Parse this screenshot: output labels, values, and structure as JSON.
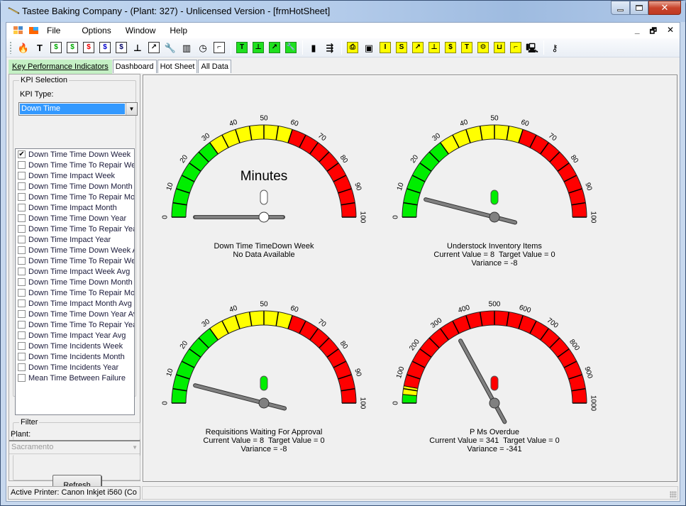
{
  "window": {
    "title": "Tastee Baking Company - (Plant: 327) - Unlicensed Version - [frmHotSheet]",
    "caption_buttons": {
      "minimize": "minimize",
      "maximize": "maximize",
      "close": "✕"
    }
  },
  "menubar": {
    "items": [
      "File",
      "Options",
      "Window",
      "Help"
    ],
    "mdi_controls": {
      "minimize": "_",
      "restore": "🗗",
      "close": "✕"
    }
  },
  "toolbar": {
    "buttons": [
      {
        "icon": "fire-icon",
        "glyph": "🔥",
        "style": "plain"
      },
      {
        "icon": "bolt-icon",
        "glyph": "T",
        "style": "plain"
      },
      {
        "icon": "dollar-doc-green-icon",
        "glyph": "$",
        "color": "#0a0"
      },
      {
        "icon": "dollar-doc-green-2-icon",
        "glyph": "$",
        "color": "#0a0"
      },
      {
        "icon": "dollar-doc-red-icon",
        "glyph": "$",
        "color": "#e00"
      },
      {
        "icon": "dollar-doc-blue-icon",
        "glyph": "$",
        "color": "#00c"
      },
      {
        "icon": "dollar-doc-navy-icon",
        "glyph": "$",
        "color": "#006"
      },
      {
        "icon": "lamp-icon",
        "glyph": "⊥",
        "style": "plain"
      },
      {
        "icon": "hammer-icon",
        "glyph": "↗"
      },
      {
        "icon": "wrench-icon",
        "glyph": "🔧",
        "style": "plain"
      },
      {
        "icon": "panel-icon",
        "glyph": "▥",
        "style": "plain"
      },
      {
        "icon": "clock-icon",
        "glyph": "◷",
        "style": "plain"
      },
      {
        "icon": "stairs-icon",
        "glyph": "⌐"
      },
      {
        "sep": true
      },
      {
        "icon": "bolt-green-icon",
        "glyph": "T",
        "style": "green"
      },
      {
        "icon": "lamp-green-icon",
        "glyph": "⊥",
        "style": "green"
      },
      {
        "icon": "hammer-green-icon",
        "glyph": "↗",
        "style": "green"
      },
      {
        "icon": "wrench-green-icon",
        "glyph": "🔧",
        "style": "green"
      },
      {
        "sep": true
      },
      {
        "icon": "bar-chart-icon",
        "glyph": "▮",
        "style": "plain"
      },
      {
        "icon": "flow-icon",
        "glyph": "⇶",
        "style": "plain"
      },
      {
        "sep": true
      },
      {
        "icon": "printer-icon",
        "glyph": "⎙",
        "style": "yellow"
      },
      {
        "icon": "monitor-icon",
        "glyph": "▣",
        "style": "plain"
      },
      {
        "icon": "signal-i-icon",
        "glyph": "I",
        "style": "yellow"
      },
      {
        "icon": "signal-s-icon",
        "glyph": "S",
        "style": "yellow"
      },
      {
        "icon": "hammer-yellow-icon",
        "glyph": "↗",
        "style": "yellow"
      },
      {
        "icon": "lamp-yellow-icon",
        "glyph": "⊥",
        "style": "yellow"
      },
      {
        "icon": "dollar-yellow-icon",
        "glyph": "$",
        "style": "yellow"
      },
      {
        "icon": "bolt-yellow-icon",
        "glyph": "T",
        "style": "yellow"
      },
      {
        "icon": "gears-yellow-icon",
        "glyph": "⚙",
        "style": "yellow"
      },
      {
        "icon": "factory-yellow-icon",
        "glyph": "⊔",
        "style": "yellow"
      },
      {
        "icon": "stairs-yellow-icon",
        "glyph": "⌐",
        "style": "yellow"
      },
      {
        "icon": "computer-icon",
        "glyph": "🖳",
        "style": "plain"
      },
      {
        "sep": true
      },
      {
        "icon": "key-icon",
        "glyph": "⚷",
        "style": "plain"
      }
    ]
  },
  "tabs": [
    {
      "label": "Key Performance Indicators",
      "active": true
    },
    {
      "label": "Dashboard",
      "active": false
    },
    {
      "label": "Hot Sheet",
      "active": false
    },
    {
      "label": "All Data",
      "active": false
    }
  ],
  "sidebar": {
    "kpi_group_title": "KPI Selection",
    "kpi_type_label": "KPI Type:",
    "kpi_type_value": "Down Time",
    "kpi_items": [
      {
        "label": "Down Time Time Down Week",
        "checked": true
      },
      {
        "label": "Down Time Time To Repair Week",
        "checked": false
      },
      {
        "label": "Down Time Impact Week",
        "checked": false
      },
      {
        "label": "Down Time Time Down Month",
        "checked": false
      },
      {
        "label": "Down Time Time To Repair Month",
        "checked": false
      },
      {
        "label": "Down Time Impact Month",
        "checked": false
      },
      {
        "label": "Down Time Time Down Year",
        "checked": false
      },
      {
        "label": "Down Time Time To Repair Year",
        "checked": false
      },
      {
        "label": "Down Time Impact Year",
        "checked": false
      },
      {
        "label": "Down Time Time Down Week Avg",
        "checked": false
      },
      {
        "label": "Down Time Time To Repair Week Avg",
        "checked": false
      },
      {
        "label": "Down Time Impact Week Avg",
        "checked": false
      },
      {
        "label": "Down Time Time Down Month Avg",
        "checked": false
      },
      {
        "label": "Down Time Time To Repair Month Avg",
        "checked": false
      },
      {
        "label": "Down Time Impact Month Avg",
        "checked": false
      },
      {
        "label": "Down Time Time Down Year Avg",
        "checked": false
      },
      {
        "label": "Down Time Time To Repair Year Avg",
        "checked": false
      },
      {
        "label": "Down Time Impact Year Avg",
        "checked": false
      },
      {
        "label": "Down Time Incidents Week",
        "checked": false
      },
      {
        "label": "Down Time Incidents Month",
        "checked": false
      },
      {
        "label": "Down Time Incidents Year",
        "checked": false
      },
      {
        "label": "Mean Time Between Failure",
        "checked": false
      }
    ],
    "filter_group_title": "Filter",
    "plant_label": "Plant:",
    "plant_value": "Sacramento",
    "refresh_label": "Refresh"
  },
  "status": {
    "printer": "Active Printer: Canon Inkjet i560 (Co"
  },
  "colors": {
    "green": "#00ee00",
    "yellow": "#ffff00",
    "red": "#ff0000",
    "needle": "#808080",
    "active_tab": "#c4f0c4",
    "selection": "#3399ff"
  },
  "chart_data": [
    {
      "type": "gauge",
      "title": "Down Time TimeDown Week",
      "unit_label": "Minutes",
      "lines": [
        "Down Time TimeDown Week",
        "No Data Available"
      ],
      "min": 0,
      "max": 100,
      "major_step": 10,
      "segments": 20,
      "ticks": [
        "0",
        "10",
        "20",
        "30",
        "40",
        "50",
        "60",
        "70",
        "80",
        "90",
        "100"
      ],
      "bands": [
        {
          "from": 0,
          "to": 30,
          "color": "green"
        },
        {
          "from": 30,
          "to": 60,
          "color": "yellow"
        },
        {
          "from": 60,
          "to": 100,
          "color": "red"
        }
      ],
      "value": null,
      "indicator": "none",
      "needle_style": "no-data"
    },
    {
      "type": "gauge",
      "title": "Understock Inventory Items",
      "lines": [
        "Understock Inventory Items",
        "Current Value = 8  Target Value = 0",
        "Variance = -8"
      ],
      "min": 0,
      "max": 100,
      "major_step": 10,
      "segments": 20,
      "ticks": [
        "0",
        "10",
        "20",
        "30",
        "40",
        "50",
        "60",
        "70",
        "80",
        "90",
        "100"
      ],
      "bands": [
        {
          "from": 0,
          "to": 30,
          "color": "green"
        },
        {
          "from": 30,
          "to": 60,
          "color": "yellow"
        },
        {
          "from": 60,
          "to": 100,
          "color": "red"
        }
      ],
      "value": 8,
      "target": 0,
      "variance": -8,
      "indicator": "green"
    },
    {
      "type": "gauge",
      "title": "Requisitions Waiting For Approval",
      "lines": [
        "Requisitions Waiting For Approval",
        "Current Value = 8  Target Value = 0",
        "Variance = -8"
      ],
      "min": 0,
      "max": 100,
      "major_step": 10,
      "segments": 20,
      "ticks": [
        "0",
        "10",
        "20",
        "30",
        "40",
        "50",
        "60",
        "70",
        "80",
        "90",
        "100"
      ],
      "bands": [
        {
          "from": 0,
          "to": 30,
          "color": "green"
        },
        {
          "from": 30,
          "to": 60,
          "color": "yellow"
        },
        {
          "from": 60,
          "to": 100,
          "color": "red"
        }
      ],
      "value": 8,
      "target": 0,
      "variance": -8,
      "indicator": "green"
    },
    {
      "type": "gauge",
      "title": "P Ms Overdue",
      "lines": [
        "P Ms Overdue",
        "Current Value = 341  Target Value = 0",
        "Variance = -341"
      ],
      "min": 0,
      "max": 1000,
      "major_step": 100,
      "segments": 20,
      "ticks": [
        "0",
        "100",
        "200",
        "300",
        "400",
        "500",
        "600",
        "700",
        "800",
        "900",
        "1000"
      ],
      "bands": [
        {
          "from": 0,
          "to": 30,
          "color": "green"
        },
        {
          "from": 30,
          "to": 60,
          "color": "yellow"
        },
        {
          "from": 60,
          "to": 1000,
          "color": "red"
        }
      ],
      "value": 341,
      "target": 0,
      "variance": -341,
      "indicator": "red"
    }
  ]
}
